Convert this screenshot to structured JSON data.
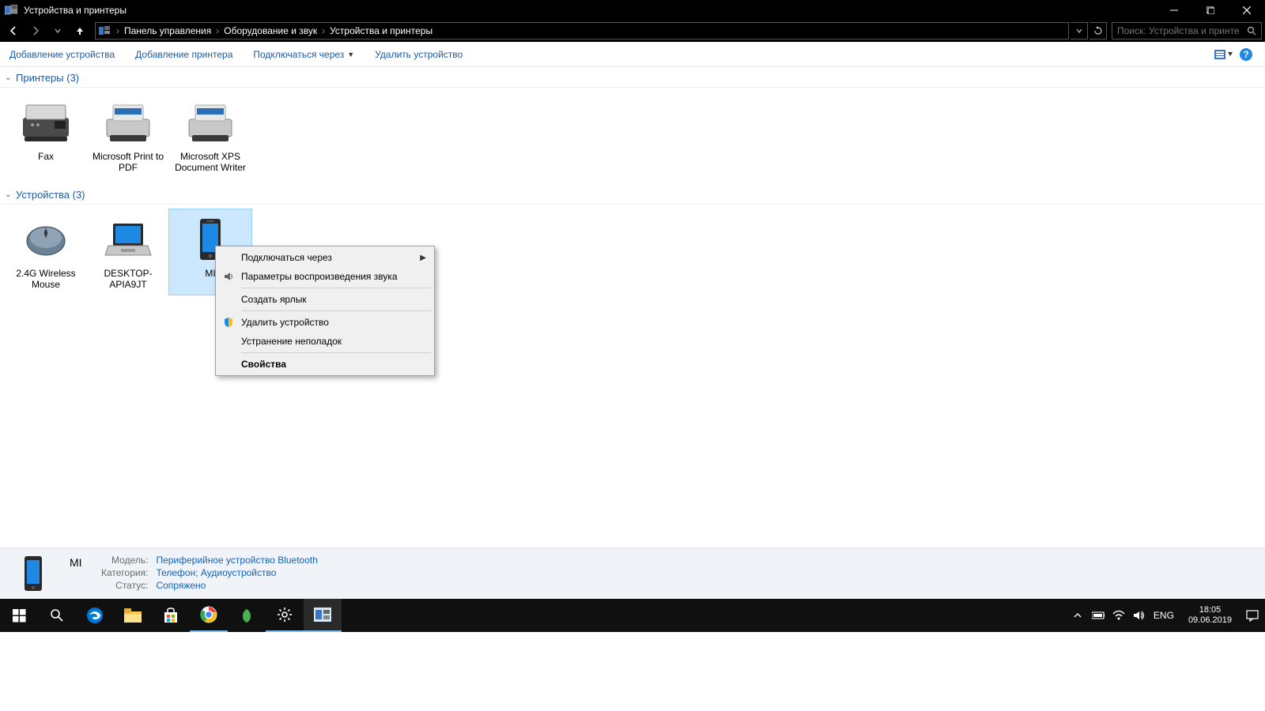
{
  "window": {
    "title": "Устройства и принтеры"
  },
  "breadcrumb": {
    "items": [
      "Панель управления",
      "Оборудование и звук",
      "Устройства и принтеры"
    ]
  },
  "search": {
    "placeholder": "Поиск: Устройства и принте..."
  },
  "commands": {
    "add_device": "Добавление устройства",
    "add_printer": "Добавление принтера",
    "connect_via": "Подключаться через",
    "remove_device": "Удалить устройство"
  },
  "groups": [
    {
      "title": "Принтеры (3)",
      "items": [
        {
          "label": "Fax",
          "icon": "fax"
        },
        {
          "label": "Microsoft Print to PDF",
          "icon": "printer"
        },
        {
          "label": "Microsoft XPS Document Writer",
          "icon": "printer"
        }
      ]
    },
    {
      "title": "Устройства (3)",
      "items": [
        {
          "label": "2.4G Wireless Mouse",
          "icon": "mouse"
        },
        {
          "label": "DESKTOP-APIA9JT",
          "icon": "laptop"
        },
        {
          "label": "MI",
          "icon": "phone",
          "selected": true
        }
      ]
    }
  ],
  "context_menu": {
    "items": [
      {
        "label": "Подключаться через",
        "submenu": true
      },
      {
        "label": "Параметры воспроизведения звука",
        "icon": "speaker"
      },
      {
        "sep": true
      },
      {
        "label": "Создать ярлык"
      },
      {
        "sep": true
      },
      {
        "label": "Удалить устройство",
        "icon": "shield"
      },
      {
        "label": "Устранение неполадок"
      },
      {
        "sep": true
      },
      {
        "label": "Свойства",
        "bold": true
      }
    ]
  },
  "details": {
    "name": "MI",
    "model_label": "Модель:",
    "model_value": "Периферийное устройство Bluetooth",
    "category_label": "Категория:",
    "category_value": "Телефон; Аудиоустройство",
    "status_label": "Статус:",
    "status_value": "Сопряжено"
  },
  "taskbar": {
    "lang": "ENG",
    "time": "18:05",
    "date": "09.06.2019"
  }
}
